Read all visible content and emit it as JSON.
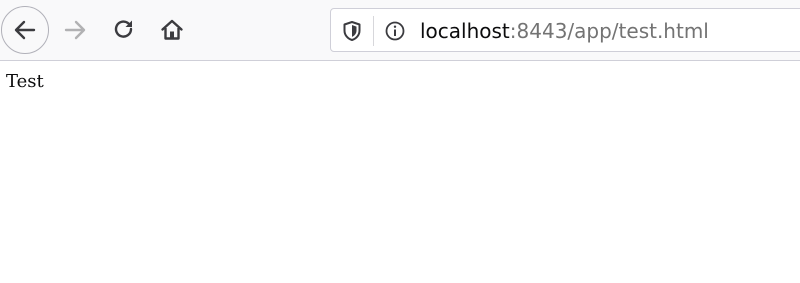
{
  "browser": {
    "toolbar": {
      "back_icon": "arrow-left-icon",
      "forward_icon": "arrow-right-icon",
      "reload_icon": "reload-icon",
      "home_icon": "home-icon"
    },
    "urlbar": {
      "tracking_icon": "shield-icon",
      "info_icon": "info-icon",
      "host": "localhost",
      "rest": ":8443/app/test.html"
    }
  },
  "page": {
    "body_text": "Test"
  },
  "colors": {
    "toolbar_bg": "#f9f9fa",
    "icon": "#3b3b3f",
    "icon_disabled": "#b1b1b3",
    "url_host": "#0c0c0d",
    "url_rest": "#737373"
  }
}
